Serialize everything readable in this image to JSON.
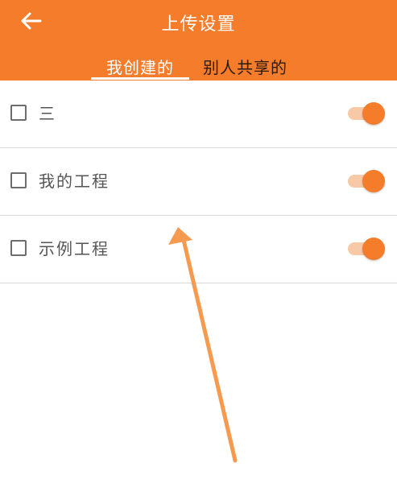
{
  "header": {
    "title": "上传设置",
    "back_icon": "arrow-left-icon",
    "background_color": "#f57c2b"
  },
  "tabs": [
    {
      "label": "我创建的",
      "active": true
    },
    {
      "label": "别人共享的",
      "active": false
    }
  ],
  "projects": [
    {
      "name": "三",
      "checked": false,
      "enabled": true
    },
    {
      "name": "我的工程",
      "checked": false,
      "enabled": true
    },
    {
      "name": "示例工程",
      "checked": false,
      "enabled": true
    }
  ],
  "annotation": {
    "type": "arrow",
    "color": "#f59a4f"
  },
  "colors": {
    "accent": "#f57c2b",
    "switch_track": "#f7c9a6"
  }
}
